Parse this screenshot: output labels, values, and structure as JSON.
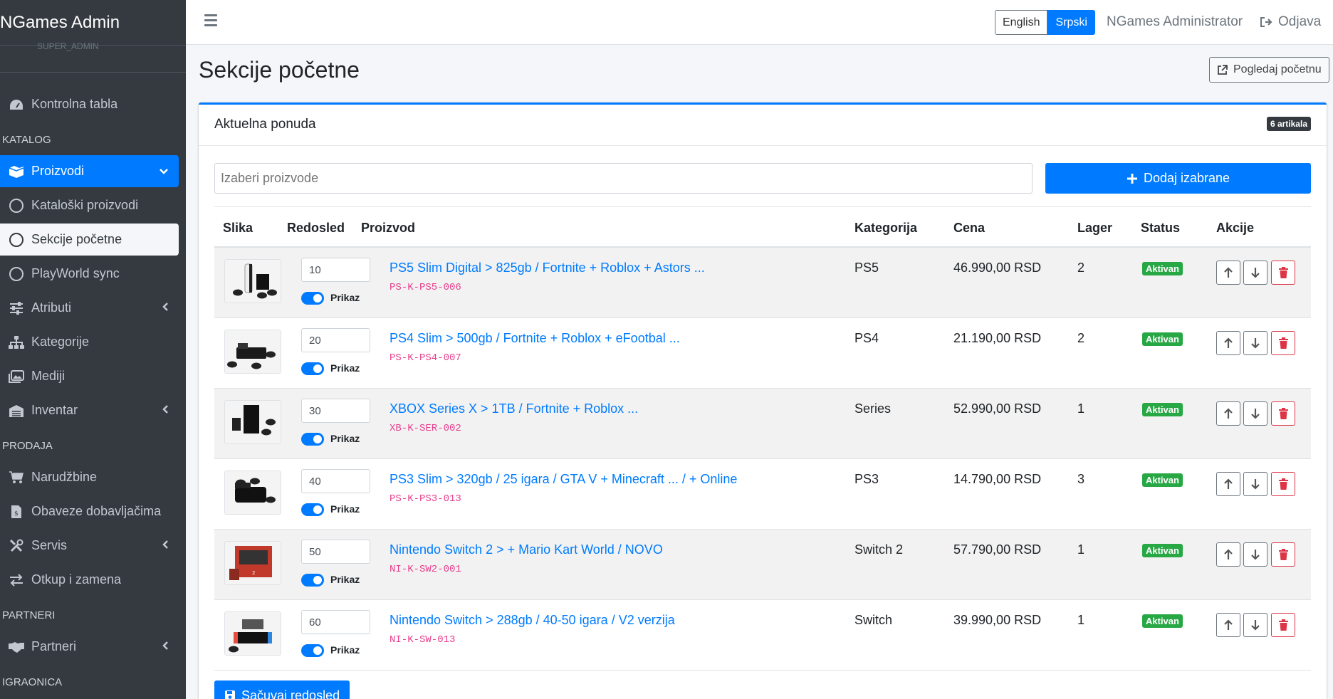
{
  "sidebar": {
    "brand": "NGames Admin",
    "role": "SUPER_ADMIN",
    "items": [
      {
        "type": "item",
        "label": "Kontrolna tabla",
        "icon": "dashboard-icon"
      },
      {
        "type": "header",
        "label": "KATALOG"
      },
      {
        "type": "item",
        "label": "Proizvodi",
        "icon": "boxes-icon",
        "state": "active",
        "arrow": "down"
      },
      {
        "type": "item",
        "label": "Kataloški proizvodi",
        "icon": "circle-icon"
      },
      {
        "type": "item",
        "label": "Sekcije početne",
        "icon": "circle-icon",
        "state": "selected"
      },
      {
        "type": "item",
        "label": "PlayWorld sync",
        "icon": "circle-icon"
      },
      {
        "type": "item",
        "label": "Atributi",
        "icon": "sliders-icon",
        "arrow": "left"
      },
      {
        "type": "item",
        "label": "Kategorije",
        "icon": "sitemap-icon"
      },
      {
        "type": "item",
        "label": "Mediji",
        "icon": "images-icon"
      },
      {
        "type": "item",
        "label": "Inventar",
        "icon": "warehouse-icon",
        "arrow": "left"
      },
      {
        "type": "header",
        "label": "PRODAJA"
      },
      {
        "type": "item",
        "label": "Narudžbine",
        "icon": "cart-icon"
      },
      {
        "type": "item",
        "label": "Obaveze dobavljačima",
        "icon": "invoice-icon"
      },
      {
        "type": "item",
        "label": "Servis",
        "icon": "tools-icon",
        "arrow": "left"
      },
      {
        "type": "item",
        "label": "Otkup i zamena",
        "icon": "exchange-icon"
      },
      {
        "type": "header",
        "label": "PARTNERI"
      },
      {
        "type": "item",
        "label": "Partneri",
        "icon": "handshake-icon",
        "arrow": "left"
      },
      {
        "type": "header",
        "label": "IGRAONICA"
      }
    ]
  },
  "topbar": {
    "languages": [
      {
        "label": "English",
        "active": false
      },
      {
        "label": "Srpski",
        "active": true
      }
    ],
    "admin_name": "NGames Administrator",
    "logout_label": "Odjava"
  },
  "page": {
    "title": "Sekcije početne",
    "view_button": "Pogledaj početnu"
  },
  "section": {
    "title": "Aktuelna ponuda",
    "count_badge": "6 artikala",
    "select_placeholder": "Izaberi proizvode",
    "add_button": "Dodaj izabrane",
    "save_button": "Sačuvaj redosled",
    "columns": [
      "Slika",
      "Redosled",
      "Proizvod",
      "Kategorija",
      "Cena",
      "Lager",
      "Status",
      "Akcije"
    ],
    "toggle_label": "Prikaz",
    "rows": [
      {
        "order": "10",
        "product": "PS5 Slim Digital > 825gb / Fortnite + Roblox + Astors ...",
        "sku": "PS-K-PS5-006",
        "category": "PS5",
        "price": "46.990,00 RSD",
        "stock": "2",
        "status": "Aktivan",
        "thumb": "ps5"
      },
      {
        "order": "20",
        "product": "PS4 Slim > 500gb / Fortnite + Roblox + eFootbal ...",
        "sku": "PS-K-PS4-007",
        "category": "PS4",
        "price": "21.190,00 RSD",
        "stock": "2",
        "status": "Aktivan",
        "thumb": "ps4"
      },
      {
        "order": "30",
        "product": "XBOX Series X > 1TB / Fortnite + Roblox ...",
        "sku": "XB-K-SER-002",
        "category": "Series",
        "price": "52.990,00 RSD",
        "stock": "1",
        "status": "Aktivan",
        "thumb": "xbox"
      },
      {
        "order": "40",
        "product": "PS3 Slim > 320gb / 25 igara / GTA V + Minecraft ... / + Online",
        "sku": "PS-K-PS3-013",
        "category": "PS3",
        "price": "14.790,00 RSD",
        "stock": "3",
        "status": "Aktivan",
        "thumb": "ps3"
      },
      {
        "order": "50",
        "product": "Nintendo Switch 2 > + Mario Kart World / NOVO",
        "sku": "NI-K-SW2-001",
        "category": "Switch 2",
        "price": "57.790,00 RSD",
        "stock": "1",
        "status": "Aktivan",
        "thumb": "switch2"
      },
      {
        "order": "60",
        "product": "Nintendo Switch > 288gb / 40-50 igara / V2 verzija",
        "sku": "NI-K-SW-013",
        "category": "Switch",
        "price": "39.990,00 RSD",
        "stock": "1",
        "status": "Aktivan",
        "thumb": "switch"
      }
    ]
  }
}
